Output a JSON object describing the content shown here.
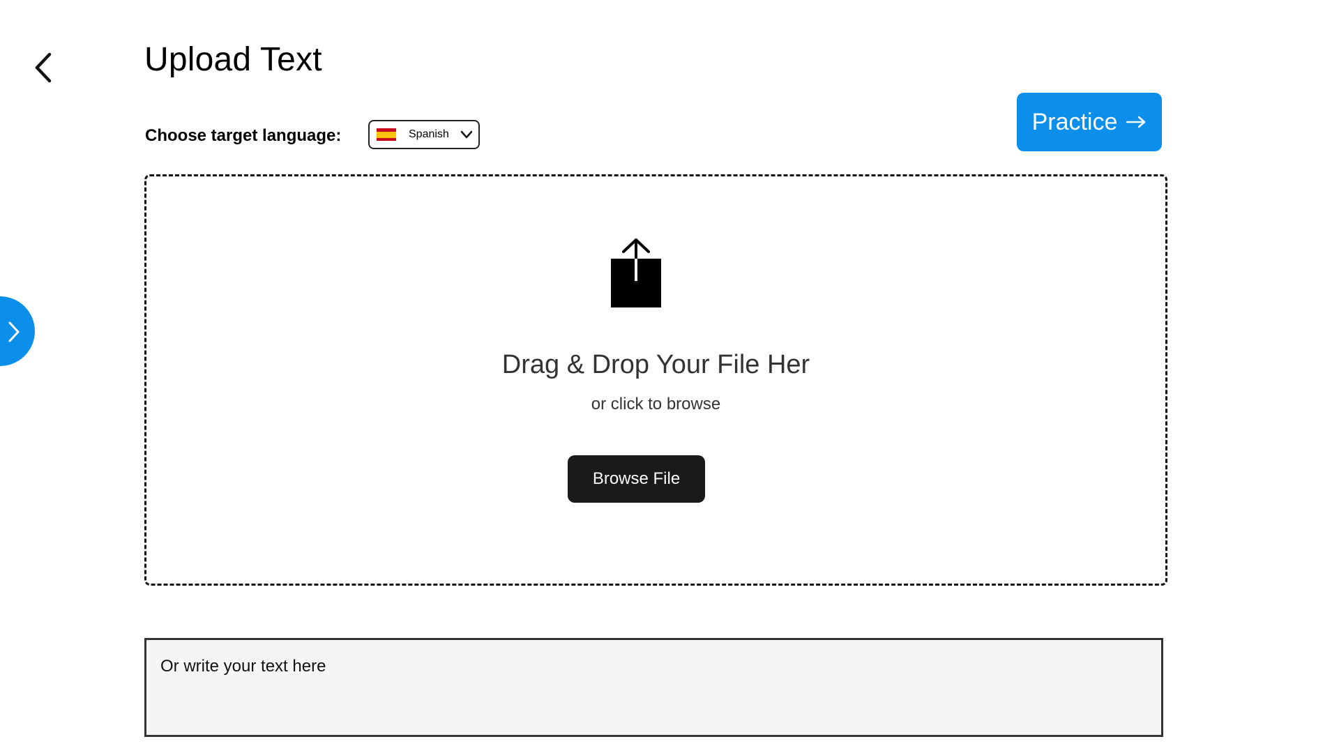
{
  "header": {
    "title": "Upload Text",
    "back_icon": "chevron-left-icon"
  },
  "language": {
    "label": "Choose target language:",
    "selected": "Spanish",
    "flag_icon": "spain-flag-icon",
    "dropdown_icon": "chevron-down-icon"
  },
  "practice": {
    "label": "Practice",
    "icon": "arrow-right-icon",
    "color": "#0b8fea"
  },
  "sidebar_toggle": {
    "icon": "chevron-right-icon",
    "color": "#0b8fea"
  },
  "dropzone": {
    "icon": "upload-icon",
    "title": "Drag & Drop Your File Her",
    "subtitle": "or click to browse",
    "browse_label": "Browse File"
  },
  "text_input": {
    "placeholder": "Or write your text here",
    "value": ""
  }
}
